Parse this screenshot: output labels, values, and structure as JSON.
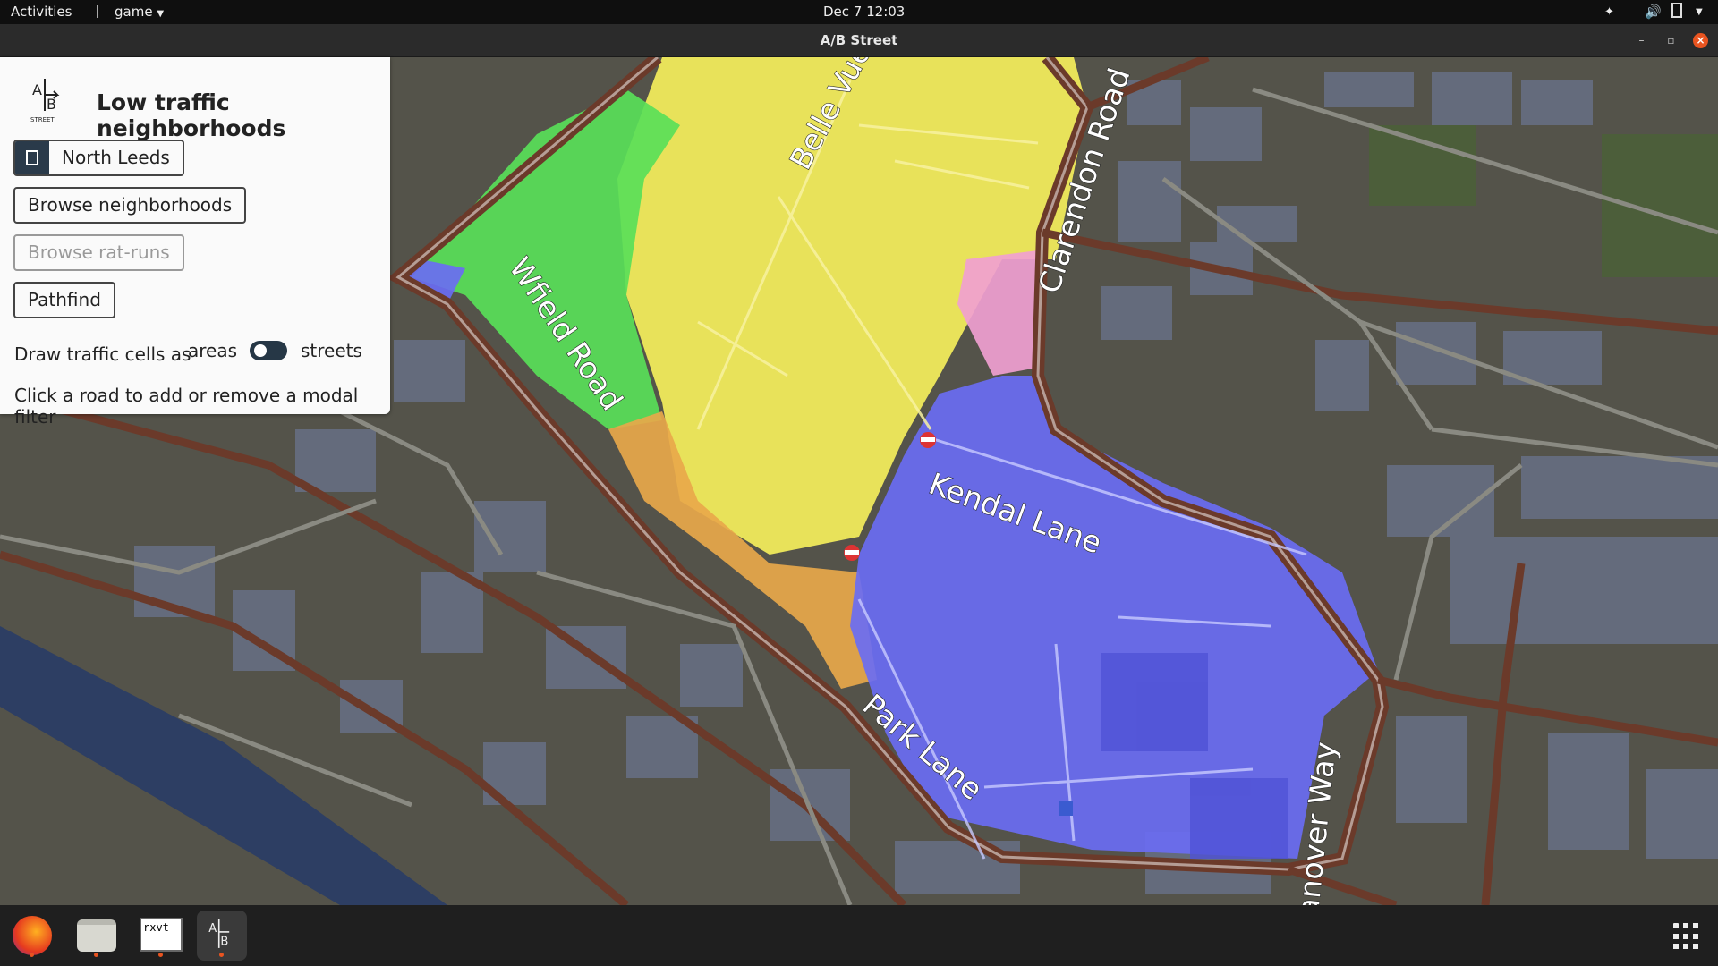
{
  "topbar": {
    "activities": "Activities",
    "app_menu": "game",
    "clock": "Dec 7  12:03"
  },
  "window": {
    "title": "A/B Street"
  },
  "panel": {
    "heading": "Low traffic neighborhoods",
    "region_button": "North Leeds",
    "browse_neighborhoods": "Browse neighborhoods",
    "browse_rat_runs": "Browse rat-runs",
    "pathfind": "Pathfind",
    "draw_cells_label": "Draw traffic cells as",
    "toggle_left": "areas",
    "toggle_right": "streets",
    "hint": "Click a road to add or remove a modal filter",
    "logo_text": "A/B STREET"
  },
  "map": {
    "road_labels": [
      "Belle Vue Road",
      "Clarendon Road",
      "Wfield Road",
      "Kendal Lane",
      "Park Lane",
      "Hanover Way"
    ],
    "cell_colors": {
      "yellow": "#f5ef5b",
      "green": "#59e058",
      "blue": "#6a6cf2",
      "orange": "#e8a84a",
      "pink": "#f0a0d0"
    }
  },
  "dock": {
    "apps": [
      "firefox-icon",
      "files-icon",
      "rxvt-icon",
      "abstreet-icon"
    ],
    "rxvt_label": "rxvt"
  }
}
